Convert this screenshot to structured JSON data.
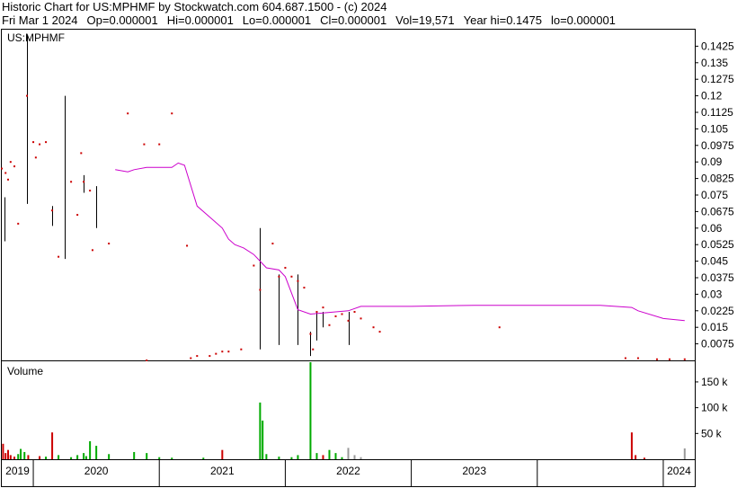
{
  "header": {
    "title_line": "Historic Chart for US:MPHMF by Stockwatch.com 604.687.1500 - (c) 2024",
    "date": "Fri Mar  1 2024",
    "open": "Op=0.000001",
    "high": "Hi=0.000001",
    "low": "Lo=0.000001",
    "close": "Cl=0.000001",
    "volume": "Vol=19,571",
    "year_high": "Year hi=0.1475",
    "year_low": "lo=0.000001"
  },
  "chart_data": {
    "type": "line",
    "symbol_label": "US:MPHMF",
    "volume_label": "Volume",
    "price_ylim": [
      0,
      0.15
    ],
    "price_ticks": [
      "0.1425",
      "0.135",
      "0.1275",
      "0.12",
      "0.1125",
      "0.105",
      "0.0975",
      "0.09",
      "0.0825",
      "0.075",
      "0.0675",
      "0.06",
      "0.0525",
      "0.045",
      "0.0375",
      "0.03",
      "0.0225",
      "0.015",
      "0.0075"
    ],
    "volume_ylim": [
      0,
      190000
    ],
    "volume_ticks": [
      {
        "label": "150 k",
        "value": 150000
      },
      {
        "label": "100 k",
        "value": 100000
      },
      {
        "label": "50 k",
        "value": 50000
      }
    ],
    "x_range": [
      2018.75,
      2024.25
    ],
    "years": [
      "2019",
      "2020",
      "2021",
      "2022",
      "2023",
      "2024"
    ],
    "year_boundaries": [
      2019.0,
      2020.0,
      2021.0,
      2022.0,
      2023.0,
      2024.0
    ],
    "colors": {
      "price": "#cc0000",
      "ma": "#cc00cc",
      "range": "#000000",
      "vol_up": "#00aa00",
      "vol_down": "#cc0000",
      "vol_flat": "#999999"
    },
    "moving_average": {
      "x": [
        2019.65,
        2019.75,
        2019.8,
        2019.9,
        2020.1,
        2020.15,
        2020.2,
        2020.3,
        2020.4,
        2020.5,
        2020.55,
        2020.6,
        2020.67,
        2020.75,
        2020.8,
        2020.85,
        2020.95,
        2021.0,
        2021.1,
        2021.2,
        2021.3,
        2021.4,
        2021.5,
        2021.6,
        2021.8,
        2022.0,
        2022.5,
        2023.0,
        2023.5,
        2023.75,
        2023.8,
        2024.0,
        2024.17
      ],
      "y": [
        0.0865,
        0.0855,
        0.0865,
        0.0875,
        0.0875,
        0.0895,
        0.0885,
        0.07,
        0.065,
        0.06,
        0.055,
        0.0525,
        0.051,
        0.048,
        0.045,
        0.042,
        0.041,
        0.038,
        0.023,
        0.021,
        0.0215,
        0.022,
        0.0225,
        0.0245,
        0.0245,
        0.0245,
        0.025,
        0.025,
        0.025,
        0.024,
        0.0225,
        0.019,
        0.018
      ]
    },
    "ranges": [
      {
        "x": 2018.77,
        "low": 0.054,
        "high": 0.074
      },
      {
        "x": 2018.95,
        "low": 0.071,
        "high": 0.1475
      },
      {
        "x": 2019.15,
        "low": 0.061,
        "high": 0.07
      },
      {
        "x": 2019.25,
        "low": 0.046,
        "high": 0.12
      },
      {
        "x": 2019.4,
        "low": 0.076,
        "high": 0.084
      },
      {
        "x": 2019.5,
        "low": 0.06,
        "high": 0.079
      },
      {
        "x": 2020.8,
        "low": 0.005,
        "high": 0.06
      },
      {
        "x": 2020.95,
        "low": 0.007,
        "high": 0.039
      },
      {
        "x": 2021.1,
        "low": 0.007,
        "high": 0.039
      },
      {
        "x": 2021.2,
        "low": 0.002,
        "high": 0.013
      },
      {
        "x": 2021.25,
        "low": 0.009,
        "high": 0.022
      },
      {
        "x": 2021.3,
        "low": 0.015,
        "high": 0.022
      },
      {
        "x": 2021.5,
        "low": 0.007,
        "high": 0.022
      }
    ],
    "closes": {
      "x": [
        2018.75,
        2018.78,
        2018.8,
        2018.82,
        2018.85,
        2018.88,
        2018.95,
        2019.0,
        2019.02,
        2019.05,
        2019.1,
        2019.15,
        2019.2,
        2019.3,
        2019.35,
        2019.38,
        2019.4,
        2019.45,
        2019.47,
        2019.6,
        2019.75,
        2019.88,
        2019.9,
        2020.0,
        2020.1,
        2020.22,
        2020.25,
        2020.3,
        2020.4,
        2020.45,
        2020.5,
        2020.55,
        2020.65,
        2020.75,
        2020.8,
        2020.9,
        2020.95,
        2021.0,
        2021.05,
        2021.1,
        2021.15,
        2021.2,
        2021.22,
        2021.25,
        2021.3,
        2021.35,
        2021.4,
        2021.45,
        2021.5,
        2021.55,
        2021.6,
        2021.7,
        2021.75,
        2022.7,
        2023.7,
        2023.8,
        2023.95,
        2024.05,
        2024.17
      ],
      "y": [
        0.087,
        0.085,
        0.082,
        0.09,
        0.088,
        0.062,
        0.12,
        0.099,
        0.092,
        0.098,
        0.099,
        0.068,
        0.047,
        0.081,
        0.066,
        0.094,
        0.081,
        0.077,
        0.05,
        0.053,
        0.112,
        0.098,
        0.0,
        0.098,
        0.112,
        0.052,
        0.001,
        0.002,
        0.002,
        0.003,
        0.004,
        0.004,
        0.005,
        0.043,
        0.032,
        0.053,
        0.038,
        0.042,
        0.038,
        0.036,
        0.033,
        0.012,
        0.005,
        0.022,
        0.024,
        0.016,
        0.02,
        0.021,
        0.018,
        0.022,
        0.019,
        0.015,
        0.013,
        0.015,
        0.001,
        0.001,
        0.0005,
        0.0005,
        0.0005
      ]
    },
    "volume": {
      "x": [
        2018.76,
        2018.78,
        2018.8,
        2018.82,
        2018.85,
        2018.88,
        2018.9,
        2018.93,
        2018.96,
        2019.05,
        2019.1,
        2019.15,
        2019.2,
        2019.3,
        2019.35,
        2019.4,
        2019.42,
        2019.45,
        2019.5,
        2019.6,
        2019.8,
        2019.9,
        2020.0,
        2020.1,
        2020.35,
        2020.5,
        2020.8,
        2020.82,
        2020.85,
        2020.95,
        2021.05,
        2021.1,
        2021.2,
        2021.25,
        2021.3,
        2021.35,
        2021.4,
        2021.45,
        2021.5,
        2021.55,
        2021.6,
        2023.75,
        2023.78,
        2023.85,
        2024.17
      ],
      "values": [
        30000,
        12000,
        18000,
        8000,
        5000,
        10000,
        20000,
        14000,
        8000,
        6000,
        5000,
        52000,
        8000,
        4000,
        8000,
        12000,
        6000,
        35000,
        26000,
        10000,
        14000,
        12000,
        4000,
        3000,
        3000,
        18000,
        110000,
        75000,
        10000,
        5000,
        4000,
        8000,
        195000,
        12000,
        8000,
        18000,
        12000,
        4000,
        22000,
        8000,
        4000,
        52000,
        8000,
        3000,
        21000
      ],
      "direction": [
        "down",
        "down",
        "down",
        "down",
        "down",
        "up",
        "up",
        "up",
        "down",
        "down",
        "up",
        "down",
        "up",
        "up",
        "up",
        "up",
        "up",
        "up",
        "up",
        "up",
        "up",
        "up",
        "up",
        "up",
        "up",
        "down",
        "up",
        "up",
        "up",
        "up",
        "up",
        "up",
        "up",
        "up",
        "down",
        "up",
        "up",
        "up",
        "flat",
        "flat",
        "flat",
        "down",
        "down",
        "down",
        "flat"
      ]
    }
  }
}
